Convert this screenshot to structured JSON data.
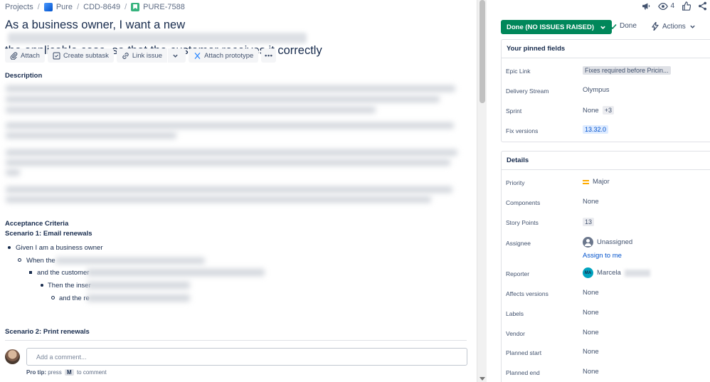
{
  "breadcrumb": {
    "items": [
      "Projects",
      "Pure",
      "CDD-8649",
      "PURE-7588"
    ]
  },
  "issue": {
    "title_line1": "As a business owner, I want a new",
    "title_line2": "the applicable case, so that the customer receives it correctly"
  },
  "toolbar": {
    "attach": "Attach",
    "create_subtask": "Create subtask",
    "link_issue": "Link issue",
    "attach_prototype": "Attach prototype"
  },
  "description": {
    "label": "Description"
  },
  "acceptance": {
    "heading": "Acceptance Criteria",
    "scenario1": "Scenario 1: Email renewals",
    "lines": [
      "Given I am a business owner",
      "When the",
      "and the customer",
      "Then the inser",
      "and the re"
    ],
    "scenario2": "Scenario 2: Print renewals"
  },
  "comment": {
    "placeholder": "Add a comment...",
    "protip_label": "Pro tip:",
    "protip_press": "press",
    "protip_key": "M",
    "protip_rest": "to comment"
  },
  "top_bar": {
    "watch_count": "4"
  },
  "status": {
    "button": "Done (NO ISSUES RAISED)",
    "done": "Done",
    "actions": "Actions"
  },
  "pinned": {
    "title": "Your pinned fields",
    "epic_link_label": "Epic Link",
    "epic_link_value": "Fixes required before Pricin...",
    "delivery_stream_label": "Delivery Stream",
    "delivery_stream_value": "Olympus",
    "sprint_label": "Sprint",
    "sprint_value": "None",
    "sprint_extra": "+3",
    "fix_versions_label": "Fix versions",
    "fix_versions_value": "13.32.0"
  },
  "details": {
    "title": "Details",
    "priority_label": "Priority",
    "priority_value": "Major",
    "components_label": "Components",
    "components_value": "None",
    "story_points_label": "Story Points",
    "story_points_value": "13",
    "assignee_label": "Assignee",
    "assignee_value": "Unassigned",
    "assign_to_me": "Assign to me",
    "reporter_label": "Reporter",
    "reporter_initials": "MA",
    "reporter_value": "Marcela",
    "affects_label": "Affects versions",
    "affects_value": "None",
    "labels_label": "Labels",
    "labels_value": "None",
    "vendor_label": "Vendor",
    "vendor_value": "None",
    "planned_start_label": "Planned start",
    "planned_start_value": "None",
    "planned_end_label": "Planned end",
    "planned_end_value": "None"
  },
  "colors": {
    "status_green": "#00875a",
    "link_blue": "#0052cc",
    "priority_major": "#ffab00"
  }
}
